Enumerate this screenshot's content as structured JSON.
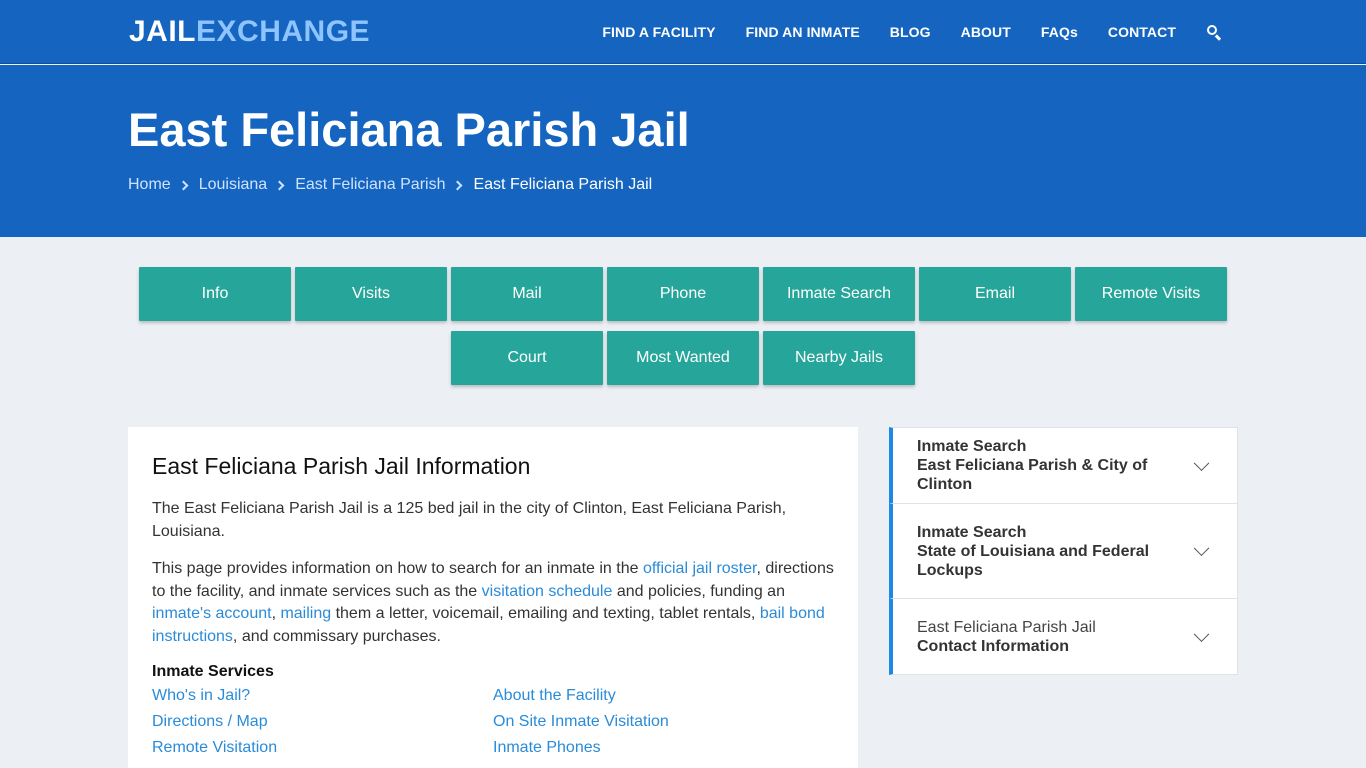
{
  "header": {
    "logo_part1": "JAIL",
    "logo_part2": "EXCHANGE",
    "nav": [
      "FIND A FACILITY",
      "FIND AN INMATE",
      "BLOG",
      "ABOUT",
      "FAQs",
      "CONTACT"
    ]
  },
  "hero": {
    "title": "East Feliciana Parish Jail",
    "breadcrumb": [
      "Home",
      "Louisiana",
      "East Feliciana Parish"
    ],
    "breadcrumb_current": "East Feliciana Parish Jail"
  },
  "tabs": [
    "Info",
    "Visits",
    "Mail",
    "Phone",
    "Inmate Search",
    "Email",
    "Remote Visits",
    "Court",
    "Most Wanted",
    "Nearby Jails"
  ],
  "main": {
    "heading": "East Feliciana Parish Jail Information",
    "para1": "The East Feliciana Parish Jail is a 125 bed jail in the city of Clinton, East Feliciana Parish, Louisiana.",
    "para2": {
      "t1": "This page provides information on how to search for an inmate in the ",
      "l1": "official jail roster",
      "t2": ", directions to the facility, and inmate services such as the ",
      "l2": "visitation schedule",
      "t3": " and policies, funding an ",
      "l3": "inmate's account",
      "t4": ", ",
      "l4": "mailing",
      "t5": " them a letter, voicemail, emailing and texting, tablet rentals, ",
      "l5": "bail bond instructions",
      "t6": ", and commissary purchases."
    },
    "services_heading": "Inmate Services",
    "services": [
      "Who's in Jail?",
      "About the Facility",
      "Directions / Map",
      "On Site Inmate Visitation",
      "Remote Visitation",
      "Inmate Phones"
    ]
  },
  "sidebar": [
    {
      "line1": "Inmate Search",
      "line2": "East Feliciana Parish & City of Clinton"
    },
    {
      "line1": "Inmate Search",
      "line2": "State of Louisiana and Federal Lockups"
    },
    {
      "line1": "East Feliciana Parish Jail",
      "line2": "Contact Information"
    }
  ],
  "colors": {
    "brand": "#1565c0",
    "tab": "#26a69a",
    "link": "#2a8bd8",
    "accent_border": "#1e88e5"
  }
}
